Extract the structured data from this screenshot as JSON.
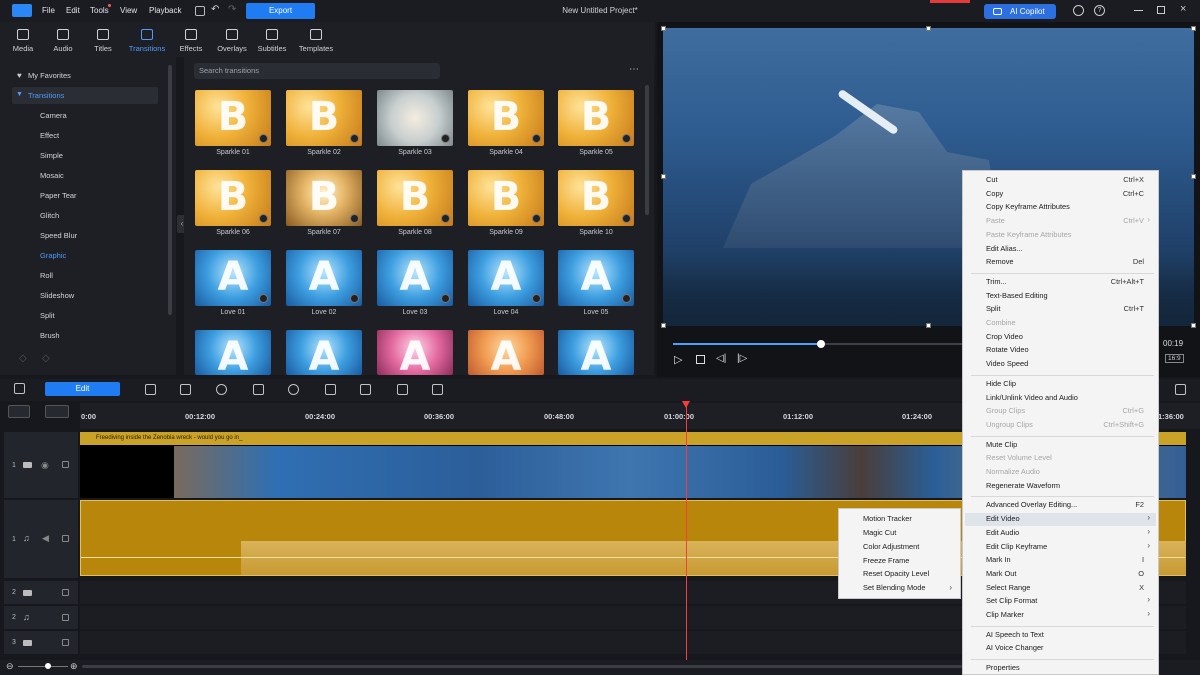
{
  "menubar": {
    "items": [
      "File",
      "Edit",
      "Tools",
      "View",
      "Playback"
    ],
    "export": "Export",
    "project": "New Untitled Project*",
    "copilot": "AI Copilot"
  },
  "tabs": [
    "Media",
    "Audio",
    "Titles",
    "Transitions",
    "Effects",
    "Overlays",
    "Subtitles",
    "Templates"
  ],
  "sidebar": {
    "favorites": "My Favorites",
    "group": "Transitions",
    "items": [
      "Camera",
      "Effect",
      "Simple",
      "Mosaic",
      "Paper Tear",
      "Glitch",
      "Speed Blur",
      "Graphic",
      "Roll",
      "Slideshow",
      "Split",
      "Brush"
    ]
  },
  "search": {
    "placeholder": "Search transitions"
  },
  "thumbs": [
    {
      "label": "Sparkle 01",
      "glyph": "B"
    },
    {
      "label": "Sparkle 02",
      "glyph": "B"
    },
    {
      "label": "Sparkle 03",
      "glyph": ""
    },
    {
      "label": "Sparkle 04",
      "glyph": "B"
    },
    {
      "label": "Sparkle 05",
      "glyph": "B"
    },
    {
      "label": "Sparkle 06",
      "glyph": "B"
    },
    {
      "label": "Sparkle 07",
      "glyph": "B"
    },
    {
      "label": "Sparkle 08",
      "glyph": "B"
    },
    {
      "label": "Sparkle 09",
      "glyph": "B"
    },
    {
      "label": "Sparkle 10",
      "glyph": "B"
    },
    {
      "label": "Love 01",
      "glyph": "A"
    },
    {
      "label": "Love 02",
      "glyph": "A"
    },
    {
      "label": "Love 03",
      "glyph": "A"
    },
    {
      "label": "Love 04",
      "glyph": "A"
    },
    {
      "label": "Love 05",
      "glyph": "A"
    },
    {
      "label": "",
      "glyph": "A"
    },
    {
      "label": "",
      "glyph": "A"
    },
    {
      "label": "",
      "glyph": "A"
    },
    {
      "label": "",
      "glyph": "A"
    },
    {
      "label": "",
      "glyph": "A"
    }
  ],
  "player": {
    "time": "00:19",
    "ratio": "16:9"
  },
  "timeline": {
    "edit": "Edit",
    "ruler": [
      "0:00",
      "00:12:00",
      "00:24:00",
      "00:36:00",
      "00:48:00",
      "01:00:00",
      "01:12:00",
      "01:24:00",
      "1:36:00"
    ],
    "clip_title": "Freediving inside the Zenobia wreck - would you go in_",
    "tracks": [
      "1",
      "1",
      "2",
      "2",
      "3"
    ]
  },
  "context_menu": [
    {
      "label": "Cut",
      "shortcut": "Ctrl+X"
    },
    {
      "label": "Copy",
      "shortcut": "Ctrl+C"
    },
    {
      "label": "Copy Keyframe Attributes",
      "shortcut": ""
    },
    {
      "label": "Paste",
      "shortcut": "Ctrl+V",
      "disabled": true,
      "sub": true
    },
    {
      "label": "Paste Keyframe Attributes",
      "shortcut": "",
      "disabled": true
    },
    {
      "label": "Edit Alias...",
      "shortcut": ""
    },
    {
      "label": "Remove",
      "shortcut": "Del"
    },
    {
      "sep": true
    },
    {
      "label": "Trim...",
      "shortcut": "Ctrl+Alt+T"
    },
    {
      "label": "Text-Based Editing",
      "shortcut": ""
    },
    {
      "label": "Split",
      "shortcut": "Ctrl+T"
    },
    {
      "label": "Combine",
      "shortcut": "",
      "disabled": true
    },
    {
      "label": "Crop Video",
      "shortcut": ""
    },
    {
      "label": "Rotate Video",
      "shortcut": ""
    },
    {
      "label": "Video Speed",
      "shortcut": ""
    },
    {
      "sep": true
    },
    {
      "label": "Hide Clip",
      "shortcut": ""
    },
    {
      "label": "Link/Unlink Video and Audio",
      "shortcut": ""
    },
    {
      "label": "Group Clips",
      "shortcut": "Ctrl+G",
      "disabled": true
    },
    {
      "label": "Ungroup Clips",
      "shortcut": "Ctrl+Shift+G",
      "disabled": true
    },
    {
      "sep": true
    },
    {
      "label": "Mute Clip",
      "shortcut": ""
    },
    {
      "label": "Reset Volume Level",
      "shortcut": "",
      "disabled": true
    },
    {
      "label": "Normalize Audio",
      "shortcut": "",
      "disabled": true
    },
    {
      "label": "Regenerate Waveform",
      "shortcut": ""
    },
    {
      "sep": true
    },
    {
      "label": "Advanced Overlay Editing...",
      "shortcut": "F2"
    },
    {
      "label": "Edit Video",
      "shortcut": "",
      "sub": true,
      "hover": true
    },
    {
      "label": "Edit Audio",
      "shortcut": "",
      "sub": true
    },
    {
      "label": "Edit Clip Keyframe",
      "shortcut": "",
      "sub": true
    },
    {
      "label": "Mark In",
      "shortcut": "I"
    },
    {
      "label": "Mark Out",
      "shortcut": "O"
    },
    {
      "label": "Select Range",
      "shortcut": "X"
    },
    {
      "label": "Set Clip Format",
      "shortcut": "",
      "sub": true
    },
    {
      "label": "Clip Marker",
      "shortcut": "",
      "sub": true
    },
    {
      "sep": true
    },
    {
      "label": "AI Speech to Text",
      "shortcut": ""
    },
    {
      "label": "AI Voice Changer",
      "shortcut": ""
    },
    {
      "sep": true
    },
    {
      "label": "Properties",
      "shortcut": ""
    }
  ],
  "submenu": [
    "Motion Tracker",
    "Magic Cut",
    "Color Adjustment",
    "Freeze Frame",
    "Reset Opacity Level",
    "Set Blending Mode"
  ],
  "colors": {
    "accent": "#1f7cf2",
    "gold_track": "#b8860b",
    "playhead": "#ff3a3a"
  },
  "playback_progress": 0.51
}
